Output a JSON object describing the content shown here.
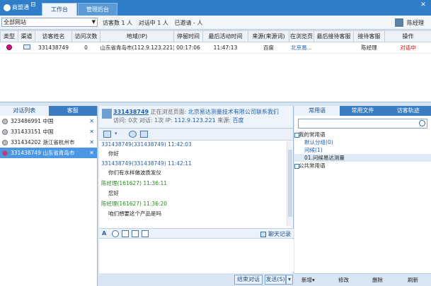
{
  "app": {
    "title": "商盟通"
  },
  "tabs": [
    "工作台",
    "管理后台"
  ],
  "window_controls": [
    "⊟",
    "✕"
  ],
  "filter": {
    "site": "全部网站",
    "visitors": "访客数 1 人",
    "chats": "对话中 1 人",
    "invited": "已邀请 - 人",
    "user": "陈经理"
  },
  "grid": {
    "headers": [
      "类型",
      "渠道",
      "访客姓名",
      "访问次数",
      "地域(IP)",
      "停留时间",
      "最后活动时间",
      "来源(来源词)",
      "在浏览页",
      "最后接待客服",
      "接待客服",
      "操作"
    ],
    "rows": [
      [
        "",
        "",
        "331438749",
        "0",
        "山东省青岛市(112.9.123.221)",
        "00:17:06",
        "11:47:13",
        "百度",
        "北京易...",
        "",
        "陈经理",
        "对话中"
      ]
    ]
  },
  "left_panel": {
    "tabs": [
      "对话列表",
      "客服"
    ],
    "items": [
      {
        "label": "323486991 中国",
        "selected": false,
        "pink": false
      },
      {
        "label": "331433151 中国",
        "selected": false,
        "pink": false
      },
      {
        "label": "331434202 浙江省杭州市",
        "selected": false,
        "pink": false
      },
      {
        "label": "331438749 山东省青岛市",
        "selected": true,
        "pink": true
      }
    ]
  },
  "chat": {
    "visitor": "331438749",
    "browsing_label": "正在浏览页面:",
    "browsing_page": "北京易达测量技术有限公司联系我们",
    "meta_1": "访问: 0次 对话: 1次 IP:",
    "ip": "112.9.123.221",
    "source_label": "来源:",
    "source": "百度",
    "messages": [
      {
        "who": "331438749(331438749)  11:42:03",
        "text": "你好",
        "me": false
      },
      {
        "who": "331438749(331438749)  11:42:11",
        "text": "你们有水样做波质发仪",
        "me": false
      },
      {
        "who": "陈经理(161627)  11:36:11",
        "text": "您好",
        "me": true
      },
      {
        "who": "陈经理(161627)  11:36:20",
        "text": "咱们想要这个产品是吗",
        "me": true
      }
    ],
    "history": "聊天记录",
    "end_button": "结束对话",
    "send_button": "发送(S)",
    "send_arrow": "▾"
  },
  "right_panel": {
    "tabs": [
      "常用语",
      "常用文件",
      "访客轨迹"
    ],
    "tree": [
      {
        "label": "我的常用语",
        "level": 1
      },
      {
        "label": "默认分组(0)",
        "level": 2
      },
      {
        "label": "问候(1)",
        "level": 2
      },
      {
        "label": "01.问候易达测量",
        "level": 3
      },
      {
        "label": "公共常用语",
        "level": 1
      }
    ],
    "bottom": {
      "add": "新增▾",
      "edit": "修改",
      "delete": "删除",
      "refresh": "刷新"
    }
  }
}
